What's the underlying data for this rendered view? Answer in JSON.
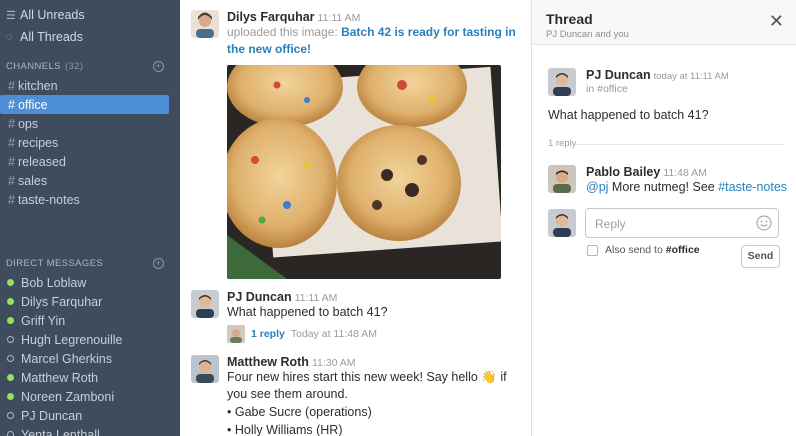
{
  "sidebar": {
    "top": [
      {
        "label": "All Unreads",
        "icon": "unreads-icon"
      },
      {
        "label": "All Threads",
        "icon": "threads-icon"
      }
    ],
    "channels_header": "CHANNELS",
    "channels_count": "(32)",
    "channels": [
      "kitchen",
      "office",
      "ops",
      "recipes",
      "released",
      "sales",
      "taste-notes"
    ],
    "active_channel": "office",
    "dm_header": "DIRECT MESSAGES",
    "dms": [
      {
        "name": "Bob Loblaw",
        "online": true
      },
      {
        "name": "Dilys Farquhar",
        "online": true
      },
      {
        "name": "Griff Yin",
        "online": true
      },
      {
        "name": "Hugh Legrenouille",
        "online": false
      },
      {
        "name": "Marcel Gherkins",
        "online": false
      },
      {
        "name": "Matthew Roth",
        "online": true
      },
      {
        "name": "Noreen Zamboni",
        "online": true
      },
      {
        "name": "PJ Duncan",
        "online": false
      },
      {
        "name": "Yenta Lenthall",
        "online": false
      }
    ]
  },
  "messages": {
    "m1": {
      "author": "Dilys Farquhar",
      "time": "11:11 AM",
      "prefix": "uploaded this image:",
      "link": "Batch 42 is ready for tasting in the new office!"
    },
    "m2": {
      "author": "PJ Duncan",
      "time": "11:11 AM",
      "text": "What happened to batch 41?",
      "reply_count": "1 reply",
      "reply_time": "Today at 11:48 AM"
    },
    "m3": {
      "author": "Matthew Roth",
      "time": "11:30 AM",
      "text_before": "Four new hires start this new week! Say hello",
      "emoji": "👋",
      "text_after": "if you see them around.",
      "bullets": [
        "• Gabe Sucre (operations)",
        "• Holly Williams (HR)"
      ]
    }
  },
  "thread": {
    "title": "Thread",
    "subtitle": "PJ Duncan and you",
    "parent": {
      "author": "PJ Duncan",
      "time": "today at 11:11 AM",
      "channel_prefix": "in",
      "channel": "#office",
      "text": "What happened to batch 41?"
    },
    "replies_label": "1 reply",
    "reply": {
      "author": "Pablo Bailey",
      "time": "11:48 AM",
      "mention": "@pj",
      "text": "More nutmeg! See",
      "channel_link": "#taste-notes"
    },
    "input_placeholder": "Reply",
    "also_send_prefix": "Also send to",
    "also_send_channel": "#office",
    "send_label": "Send"
  },
  "colors": {
    "sidebar_bg": "#3e4c5e",
    "active_channel_bg": "#4c8fd6",
    "online_dot": "#94e15b",
    "link": "#2a80b9"
  }
}
